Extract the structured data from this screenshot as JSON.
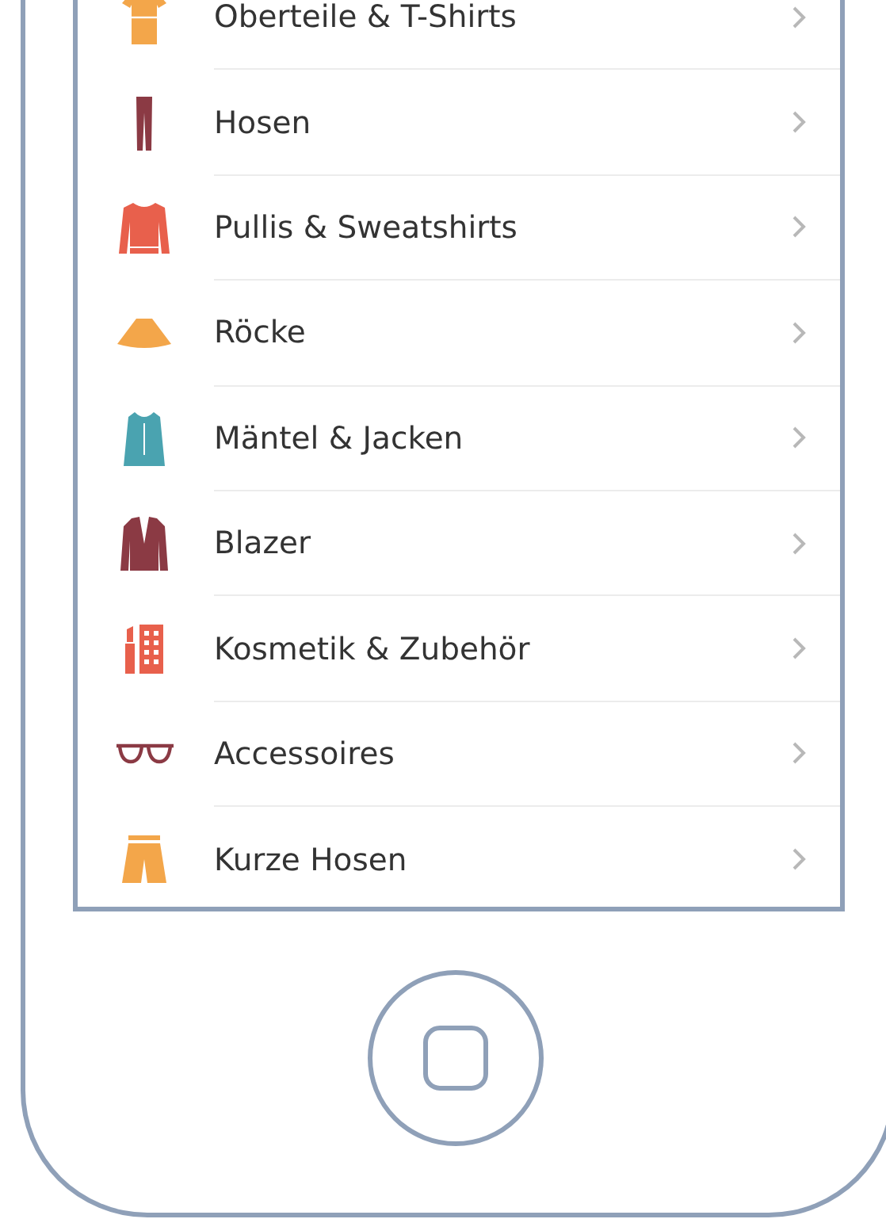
{
  "categories": [
    {
      "label": "Oberteile & T-Shirts"
    },
    {
      "label": "Hosen"
    },
    {
      "label": "Pullis & Sweatshirts"
    },
    {
      "label": "Röcke"
    },
    {
      "label": "Mäntel & Jacken"
    },
    {
      "label": "Blazer"
    },
    {
      "label": "Kosmetik & Zubehör"
    },
    {
      "label": "Accessoires"
    },
    {
      "label": "Kurze Hosen"
    }
  ]
}
